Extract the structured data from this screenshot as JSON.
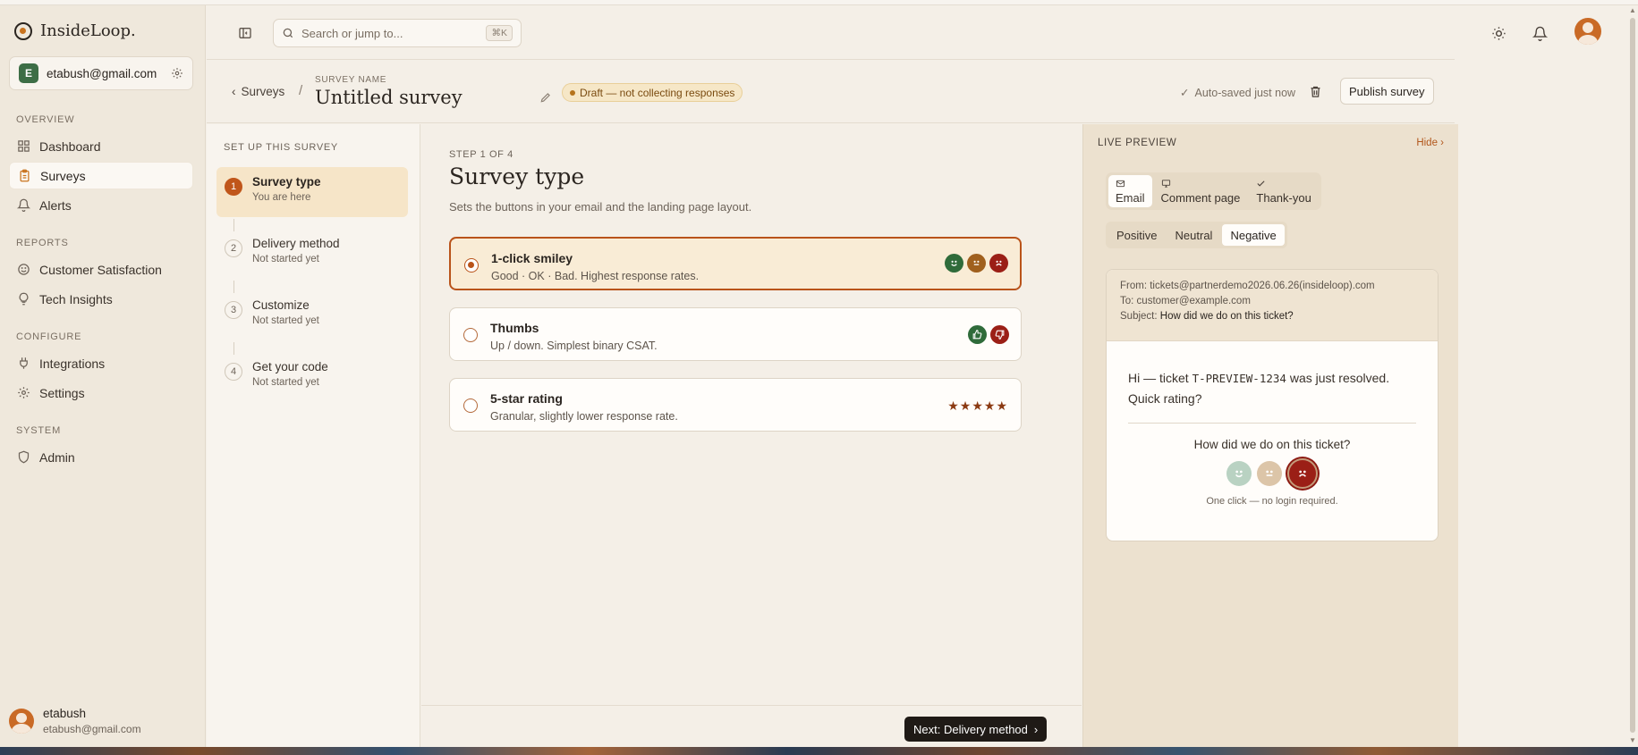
{
  "app": {
    "name": "InsideLoop.",
    "account_badge": "E",
    "account_email": "etabush@gmail.com"
  },
  "sidebar": {
    "sections": [
      {
        "title": "OVERVIEW",
        "items": [
          {
            "label": "Dashboard",
            "icon": "grid-icon"
          },
          {
            "label": "Surveys",
            "icon": "clipboard-icon",
            "active": true
          },
          {
            "label": "Alerts",
            "icon": "bell-icon"
          }
        ]
      },
      {
        "title": "REPORTS",
        "items": [
          {
            "label": "Customer Satisfaction",
            "icon": "smile-icon"
          },
          {
            "label": "Tech Insights",
            "icon": "lightbulb-icon"
          }
        ]
      },
      {
        "title": "CONFIGURE",
        "items": [
          {
            "label": "Integrations",
            "icon": "plug-icon"
          },
          {
            "label": "Settings",
            "icon": "gear-icon"
          }
        ]
      },
      {
        "title": "SYSTEM",
        "items": [
          {
            "label": "Admin",
            "icon": "shield-icon"
          }
        ]
      }
    ],
    "user": {
      "name": "etabush",
      "email": "etabush@gmail.com"
    }
  },
  "topbar": {
    "search_placeholder": "Search or jump to...",
    "search_shortcut": "⌘K"
  },
  "titlebar": {
    "back_label": "Surveys",
    "separator": "/",
    "survey_name_label": "SURVEY NAME",
    "survey_title": "Untitled survey",
    "status_badge": "Draft — not collecting responses",
    "autosave": "Auto-saved just now",
    "publish_label": "Publish survey"
  },
  "steps": {
    "heading": "SET UP THIS SURVEY",
    "items": [
      {
        "num": "1",
        "title": "Survey type",
        "sub": "You are here",
        "active": true
      },
      {
        "num": "2",
        "title": "Delivery method",
        "sub": "Not started yet"
      },
      {
        "num": "3",
        "title": "Customize",
        "sub": "Not started yet"
      },
      {
        "num": "4",
        "title": "Get your code",
        "sub": "Not started yet"
      }
    ]
  },
  "main": {
    "step_of": "STEP 1 OF 4",
    "title": "Survey type",
    "description": "Sets the buttons in your email and the landing page layout.",
    "options": [
      {
        "title": "1-click smiley",
        "desc": "Good · OK · Bad. Highest response rates.",
        "selected": true
      },
      {
        "title": "Thumbs",
        "desc": "Up / down. Simplest binary CSAT."
      },
      {
        "title": "5-star rating",
        "desc": "Granular, slightly lower response rate.",
        "stars": "★★★★★"
      }
    ],
    "next_label": "Next: Delivery method"
  },
  "preview": {
    "heading": "LIVE PREVIEW",
    "hide_label": "Hide ›",
    "tabs": [
      "Email",
      "Comment page",
      "Thank-you"
    ],
    "active_tab": "Email",
    "sentiments": [
      "Positive",
      "Neutral",
      "Negative"
    ],
    "active_sentiment": "Negative",
    "email": {
      "from_label": "From:",
      "from": "tickets@partnerdemo2026.06.26(insideloop).com",
      "to_label": "To:",
      "to": "customer@example.com",
      "subject_label": "Subject:",
      "subject": "How did we do on this ticket?",
      "body_pre": "Hi — ticket ",
      "ticket_id": "T-PREVIEW-1234",
      "body_post": " was just resolved. Quick rating?",
      "question": "How did we do on this ticket?",
      "footnote": "One click — no login required."
    }
  },
  "colors": {
    "accent": "#b9531a",
    "good": "#2f6b3a",
    "ok": "#a0601e",
    "bad": "#9b1f16"
  }
}
